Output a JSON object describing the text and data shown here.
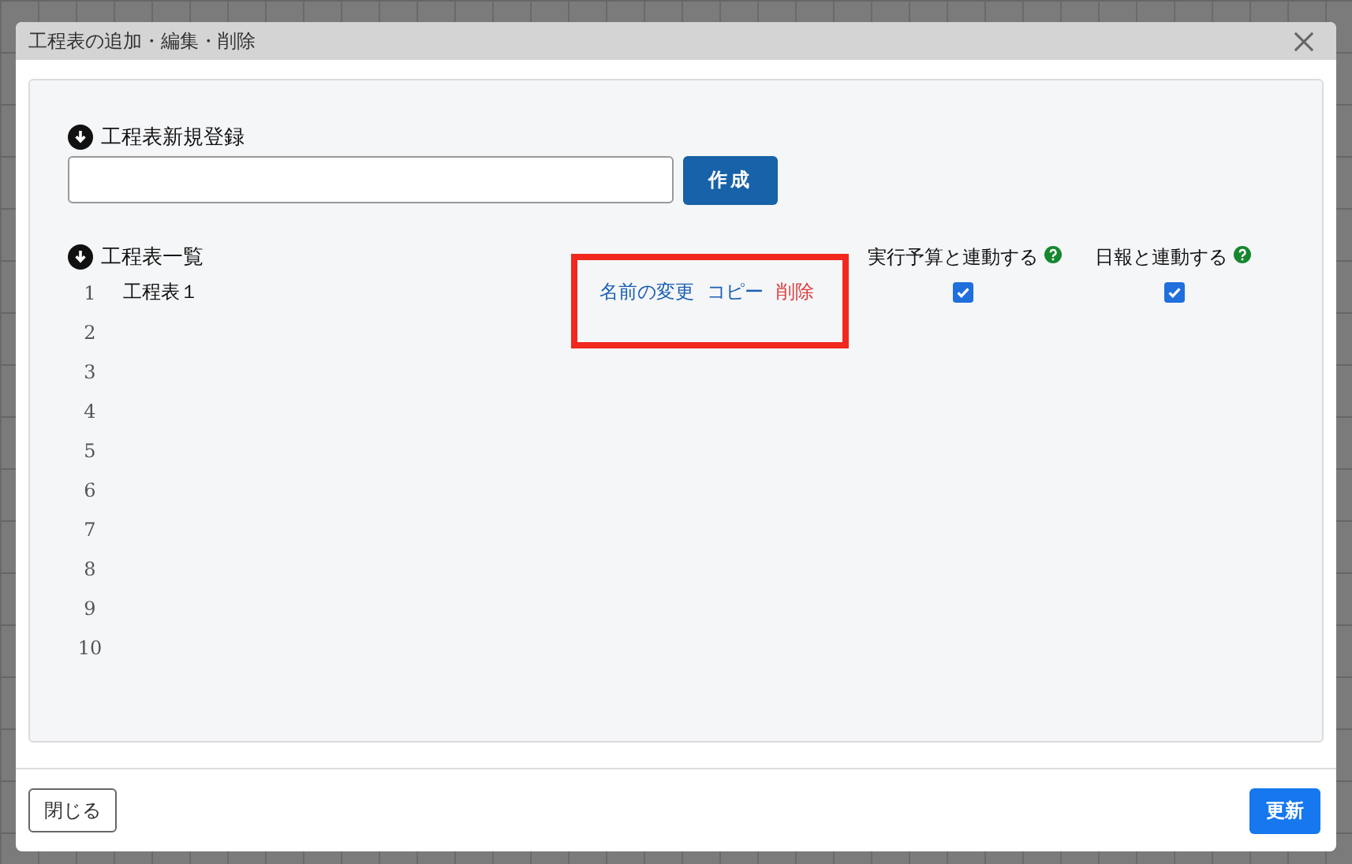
{
  "dialog": {
    "title": "工程表の追加・編集・削除",
    "new_section": {
      "title": "工程表新規登録",
      "create_button": "作成"
    },
    "list_section": {
      "title": "工程表一覧",
      "columns": [
        "実行予算と連動する",
        "日報と連動する"
      ],
      "rows": [
        {
          "number": "1",
          "name": "工程表１",
          "highlighted": true,
          "actions": [
            {
              "label": "名前の変更",
              "kind": "link"
            },
            {
              "label": "コピー",
              "kind": "link"
            },
            {
              "label": "削除",
              "kind": "danger"
            }
          ],
          "budget_linked": true,
          "report_linked": true
        },
        {
          "number": "2"
        },
        {
          "number": "3"
        },
        {
          "number": "4"
        },
        {
          "number": "5"
        },
        {
          "number": "6"
        },
        {
          "number": "7"
        },
        {
          "number": "8"
        },
        {
          "number": "9"
        },
        {
          "number": "10"
        }
      ]
    },
    "footer": {
      "close_button": "閉じる",
      "update_button": "更新"
    }
  }
}
